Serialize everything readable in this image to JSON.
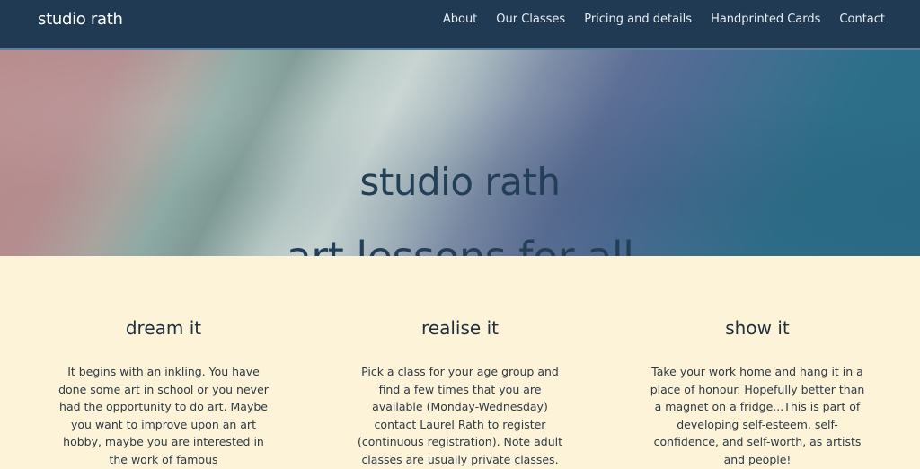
{
  "header": {
    "brand": "studio rath",
    "nav": [
      {
        "label": "About"
      },
      {
        "label": "Our Classes"
      },
      {
        "label": "Pricing and details"
      },
      {
        "label": "Handprinted Cards"
      },
      {
        "label": "Contact"
      }
    ]
  },
  "hero": {
    "line1": "studio rath",
    "line2": "art lessons for all"
  },
  "columns": [
    {
      "title": "dream it",
      "text": "It begins with an inkling. You have done some art in school or you never had the opportunity to do art. Maybe you want to improve upon an art hobby, maybe you are interested in the work of famous"
    },
    {
      "title": "realise it",
      "text": "Pick a class for your age group and find a few times that you are available (Monday-Wednesday) contact Laurel Rath to register (continuous registration). Note adult classes are usually private classes."
    },
    {
      "title": "show it",
      "text": "Take your work home and hang it in a place of honour. Hopefully better than a magnet on a fridge...This is part of developing self-esteem, self-confidence, and self-worth, as artists and people!"
    }
  ],
  "colors": {
    "nav_bg": "#1f3a52",
    "page_bg": "#fdf3d8",
    "hero_text": "#233e57"
  }
}
